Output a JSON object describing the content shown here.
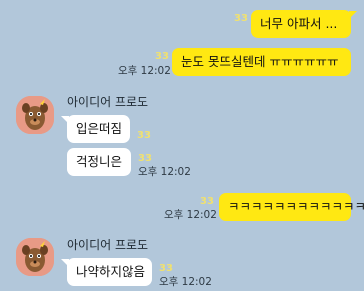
{
  "messages": {
    "m1": {
      "text": "너무 아파서 ...",
      "unread": "33"
    },
    "m2": {
      "text": "눈도 못뜨실텐데 ㅠㅠㅠㅠㅠㅠ",
      "unread": "33",
      "time": "오후 12:02"
    },
    "m3": {
      "sender": "아이디어 프로도",
      "text": "입은떠짐",
      "unread": "33"
    },
    "m4": {
      "text": "걱정니은",
      "unread": "33",
      "time": "오후 12:02"
    },
    "m5": {
      "text": "ㅋㅋㅋㅋㅋㅋㅋㅋㅋㅋㅋㅋ",
      "unread": "33",
      "time": "오후 12:02"
    },
    "m6": {
      "sender": "아이디어 프로도",
      "text": "나약하지않음",
      "unread": "33",
      "time": "오후 12:02"
    }
  },
  "colors": {
    "background": "#b2c7da",
    "my_bubble": "#ffe812",
    "their_bubble": "#ffffff",
    "unread": "#f0e170"
  },
  "icons": {
    "avatar": "ryan-dog-avatar-icon"
  }
}
